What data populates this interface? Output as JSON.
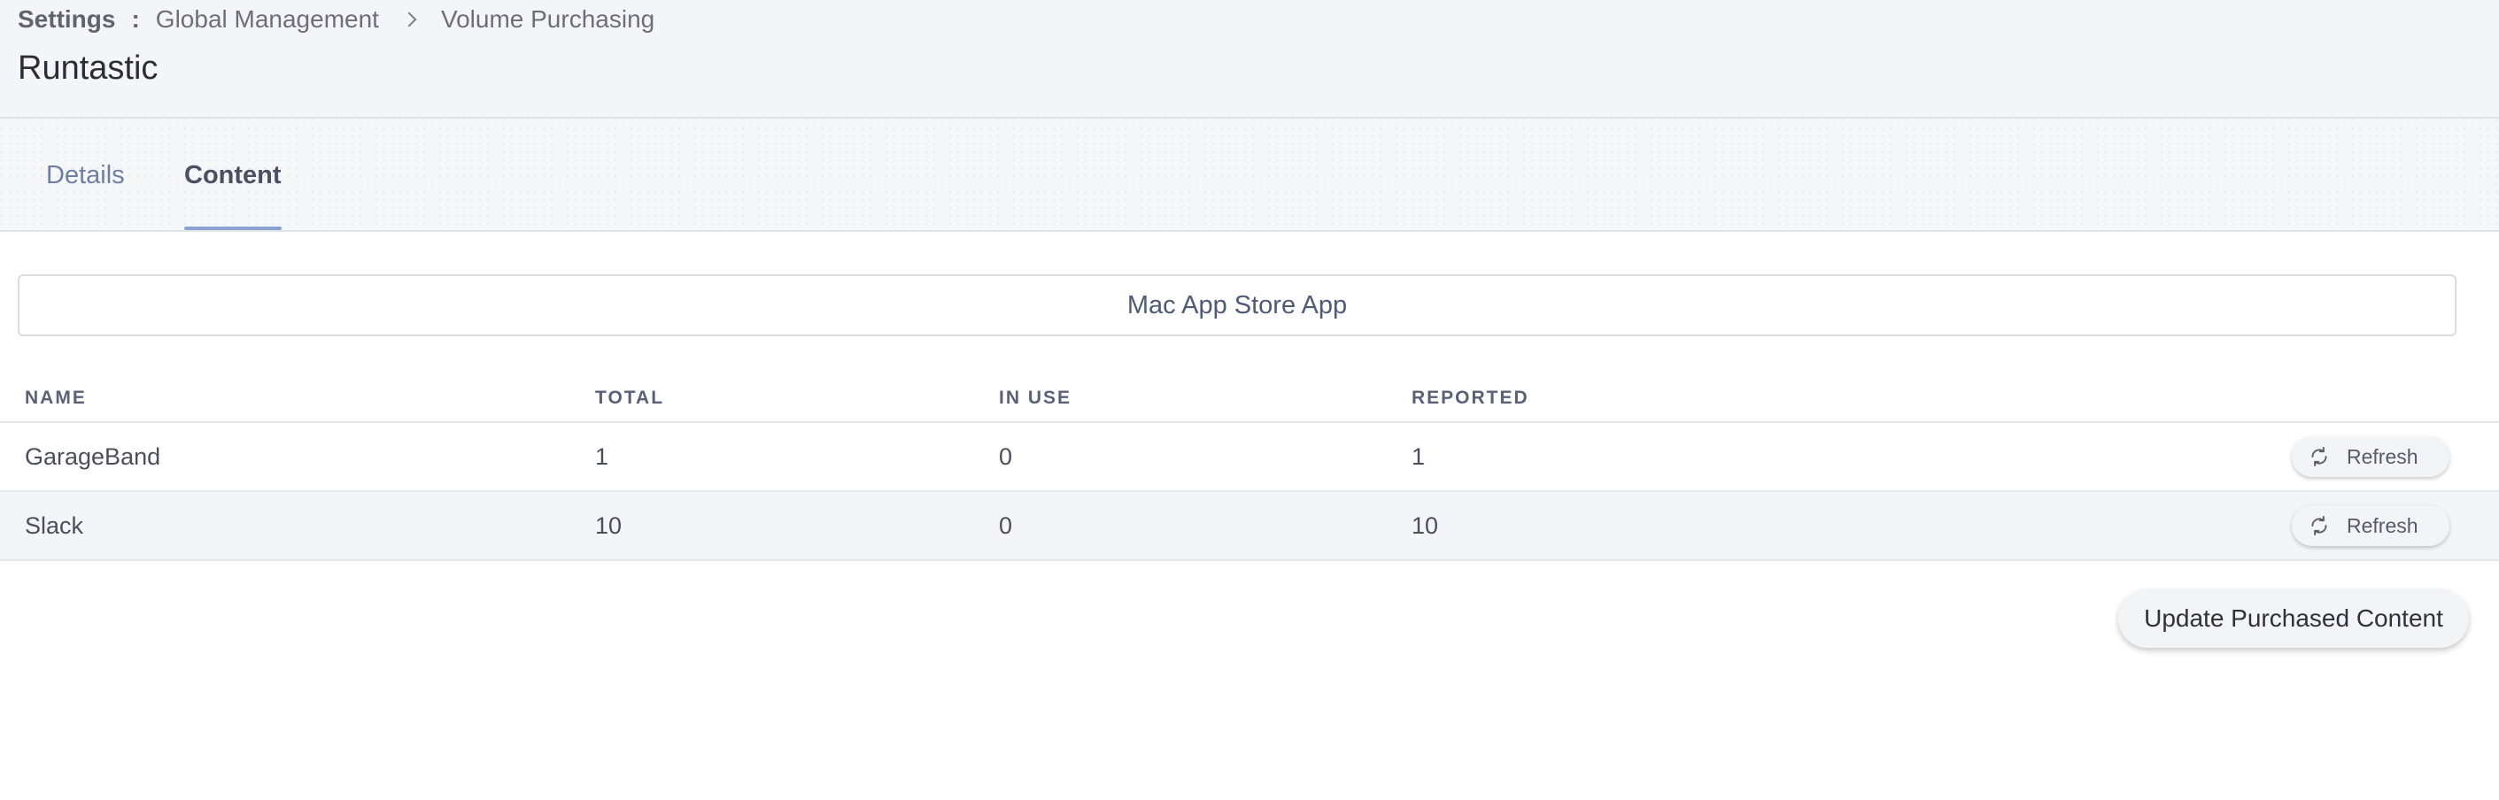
{
  "breadcrumb": {
    "root": "Settings",
    "separator": ":",
    "items": [
      "Global Management",
      "Volume Purchasing"
    ]
  },
  "page_title": "Runtastic",
  "tabs": [
    {
      "label": "Details",
      "active": false
    },
    {
      "label": "Content",
      "active": true
    }
  ],
  "section": {
    "title": "Mac App Store App"
  },
  "table": {
    "columns": [
      "NAME",
      "TOTAL",
      "IN USE",
      "REPORTED"
    ],
    "rows": [
      {
        "name": "GarageBand",
        "total": "1",
        "in_use": "0",
        "reported": "1",
        "action": "Refresh"
      },
      {
        "name": "Slack",
        "total": "10",
        "in_use": "0",
        "reported": "10",
        "action": "Refresh"
      }
    ]
  },
  "actions": {
    "update_label": "Update Purchased Content"
  },
  "icons": {
    "refresh": "refresh-icon",
    "breadcrumb_separator": "chevron-right-icon"
  },
  "colors": {
    "header_bg": "#f4f5f8",
    "tab_active_underline": "#8aa2cf",
    "tab_inactive_text": "#6f7fa3",
    "row_alt_bg": "#f4f5f8"
  }
}
